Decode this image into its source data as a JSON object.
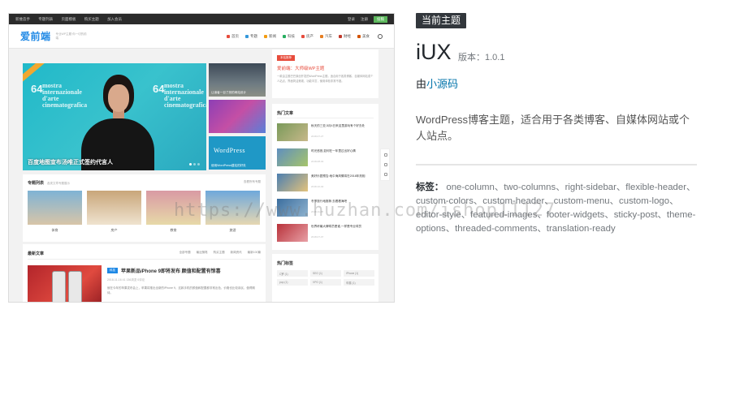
{
  "theme_header": {
    "badge": "当前主题",
    "name": "iUX",
    "version": "版本：1.0.1",
    "author_prefix": "由",
    "author": "小源码",
    "description": "WordPress博客主题，适合用于各类博客、自媒体网站或个人站点。",
    "tags_label": "标签：",
    "tags": "one-column、two-columns、right-sidebar、flexible-header、custom-colors、custom-header、custom-menu、custom-logo、editor-style、featured-images、footer-widgets、sticky-post、theme-options、threaded-comments、translation-ready"
  },
  "watermark": "https://www.huzhan.com/ishop11127",
  "preview": {
    "topbar": {
      "left": [
        "新维造手",
        "专题列表",
        "页面模板",
        "购买主题",
        "加入会员"
      ],
      "login": "登录",
      "register": "注册",
      "submit": "投稿"
    },
    "logo": "爱前端",
    "slogan": "专业WP主题 你一切的前端",
    "nav": [
      {
        "label": "首页",
        "color": "#e74c3c"
      },
      {
        "label": "专题",
        "color": "#3498db"
      },
      {
        "label": "新闻",
        "color": "#f39c12"
      },
      {
        "label": "科技",
        "color": "#27ae60"
      },
      {
        "label": "房产",
        "color": "#e74c3c"
      },
      {
        "label": "汽车",
        "color": "#e67e22"
      },
      {
        "label": "财经",
        "color": "#c0392b"
      },
      {
        "label": "美食",
        "color": "#d35400"
      }
    ],
    "hero": {
      "watermark_lines": [
        "mostra",
        "internazionale",
        "d'arte",
        "cinematografica"
      ],
      "year": "64",
      "caption": "百度地图宣布汤唯正式签约代言人"
    },
    "side_thumbs": [
      {
        "caption": "让读者一目了然的网站设计"
      },
      {
        "caption": ""
      },
      {
        "caption": "使用WordPress建站的好处",
        "logo": "WordPress"
      }
    ],
    "topics": {
      "title": "专题列表",
      "subtitle": "各类文章专题展示",
      "more": "查看所有专题",
      "items": [
        {
          "label": "体育",
          "colors": [
            "#7fb3d5",
            "#d8c5a8"
          ]
        },
        {
          "label": "房产",
          "colors": [
            "#c9a67a",
            "#efe3cf"
          ]
        },
        {
          "label": "教育",
          "colors": [
            "#d99aa4",
            "#e7d9a8"
          ]
        },
        {
          "label": "旅游",
          "colors": [
            "#6fa8dc",
            "#e6d7b2"
          ]
        }
      ]
    },
    "latest": {
      "title": "最新文章",
      "tabs": [
        "全部专题",
        "最近随笔",
        "购买主题",
        "新闻资讯",
        "最新100篇"
      ],
      "post_tag": "科技",
      "post_title": "苹果新品iPhone 9即将发布 颜值和配置有惊喜",
      "post_meta": "2018-11-16   41   136浏览   0评论",
      "post_desc": "就在今年的苹果发布会上，苹果将推出全新的iPhone 9，这款手机的颜值和配置都非常出色，价格也比较亲民，值得期待。"
    },
    "sidebar": {
      "promo_badge": "本站推荐",
      "promo_title": "爱前端：大师级WP主题",
      "promo_desc": "一款由主题巴巴原创开发的WordPress主题，适合用于各类博客、自媒体网站或个人站点，界面简洁美观，功能丰富，使用体验非常不错。",
      "hot_title": "热门文章",
      "hot": [
        {
          "title": "秋天的三亚,5月4日来这里游玩有个好去处",
          "date": "2018-07-27"
        },
        {
          "title": "时光悠悠,如何在一年里过出好心情",
          "date": "2018-08-02"
        },
        {
          "title": "美好乐园预告:地中海风情将在2018年亮相",
          "date": "2018-10-02"
        },
        {
          "title": "冬季旅行地推荐,去看看海吧",
          "date": "2018-11-05"
        },
        {
          "title": "世界杯最大牌球员是谁,一样是专业球员",
          "date": "2018-07-07"
        }
      ],
      "tags_title": "热门标签",
      "chips": [
        "C罗 (1)",
        "SEO (1)",
        "iPhone (1)",
        "pop (1)",
        "VPO (1)",
        "车展 (1)"
      ]
    }
  }
}
